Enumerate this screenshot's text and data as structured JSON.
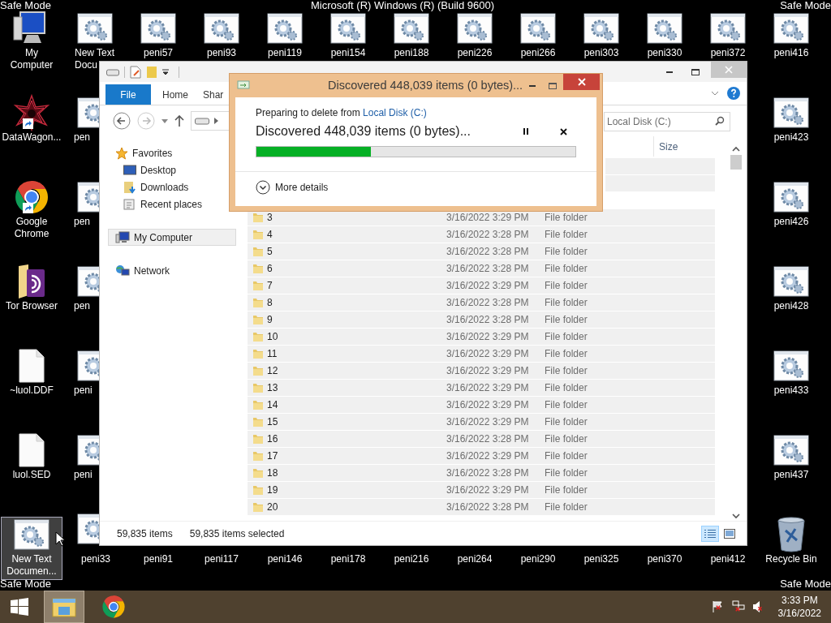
{
  "overlay_texts": {
    "safe_mode": [
      "Safe Mode",
      "Safe Mode",
      "Safe Mode",
      "Safe Mode"
    ],
    "build": "Microsoft (R) Windows (R) (Build 9600)"
  },
  "desktop": {
    "columns": [
      [
        {
          "label": "My Computer",
          "kind": "computer",
          "shortcut": false,
          "selected": false
        },
        {
          "label": "DataWagon...",
          "kind": "star",
          "shortcut": true,
          "selected": false
        },
        {
          "label": "Google Chrome",
          "kind": "chrome",
          "shortcut": true,
          "selected": false
        },
        {
          "label": "Tor Browser",
          "kind": "tor",
          "shortcut": false,
          "selected": false
        },
        {
          "label": "~luol.DDF",
          "kind": "file",
          "shortcut": false,
          "selected": false
        },
        {
          "label": "luol.SED",
          "kind": "file",
          "shortcut": false,
          "selected": false
        },
        {
          "label": "New Text Documen...",
          "kind": "gear",
          "shortcut": false,
          "selected": true
        }
      ],
      [
        {
          "label": "New Text Docu",
          "kind": "gear",
          "shortcut": false,
          "selected": false
        },
        {
          "label": "pen",
          "kind": "gear",
          "shortcut": false,
          "selected": false
        },
        {
          "label": "pen",
          "kind": "gear",
          "shortcut": false,
          "selected": false
        },
        {
          "label": "pen",
          "kind": "gear",
          "shortcut": false,
          "selected": false
        },
        {
          "label": "peni",
          "kind": "gear",
          "shortcut": false,
          "selected": false
        },
        {
          "label": "peni",
          "kind": "gear",
          "shortcut": false,
          "selected": false
        },
        {
          "label": "peni33",
          "kind": "gear",
          "shortcut": false,
          "selected": false
        }
      ],
      [
        {
          "label": "peni57",
          "kind": "gear",
          "shortcut": false,
          "selected": false
        },
        {
          "label": "peni91",
          "selected": false
        }
      ],
      [
        {
          "label": "peni93",
          "kind": "gear",
          "shortcut": false,
          "selected": false
        },
        {
          "label": "peni117",
          "selected": false
        }
      ],
      [
        {
          "label": "peni119",
          "kind": "gear",
          "shortcut": false,
          "selected": false
        },
        {
          "label": "peni146",
          "selected": false
        }
      ],
      [
        {
          "label": "peni154",
          "kind": "gear",
          "shortcut": false,
          "selected": false
        },
        {
          "label": "peni178",
          "selected": false
        }
      ],
      [
        {
          "label": "peni188",
          "kind": "gear",
          "shortcut": false,
          "selected": false
        },
        {
          "label": "peni216",
          "selected": false
        }
      ],
      [
        {
          "label": "peni226",
          "kind": "gear",
          "shortcut": false,
          "selected": false
        },
        {
          "label": "peni264",
          "selected": false
        }
      ],
      [
        {
          "label": "peni266",
          "kind": "gear",
          "shortcut": false,
          "selected": false
        },
        {
          "label": "peni290",
          "selected": false
        }
      ],
      [
        {
          "label": "peni303",
          "kind": "gear",
          "shortcut": false,
          "selected": false
        },
        {
          "label": "peni325",
          "selected": false
        }
      ],
      [
        {
          "label": "peni330",
          "kind": "gear",
          "shortcut": false,
          "selected": false
        },
        {
          "label": "peni370",
          "selected": false
        }
      ],
      [
        {
          "label": "peni372",
          "kind": "gear",
          "shortcut": false,
          "selected": false
        },
        {
          "label": "peni412",
          "selected": false
        }
      ],
      [
        {
          "label": "peni416",
          "kind": "gear",
          "shortcut": false,
          "selected": false
        },
        {
          "label": "peni423",
          "kind": "gear",
          "shortcut": false,
          "selected": false
        },
        {
          "label": "peni426",
          "kind": "gear",
          "shortcut": false,
          "selected": false
        },
        {
          "label": "peni428",
          "kind": "gear",
          "shortcut": false,
          "selected": false
        },
        {
          "label": "peni433",
          "kind": "gear",
          "shortcut": false,
          "selected": false
        },
        {
          "label": "peni437",
          "kind": "gear",
          "shortcut": false,
          "selected": false
        },
        {
          "label": "Recycle Bin",
          "kind": "recycle",
          "shortcut": false,
          "selected": false
        }
      ]
    ]
  },
  "explorer": {
    "ribbon_tabs": [
      {
        "label": "File",
        "selected": true
      },
      {
        "label": "Home",
        "selected": false
      },
      {
        "label": "Shar",
        "selected": false
      }
    ],
    "search": {
      "placeholder": "Local Disk (C:)"
    },
    "nav": [
      {
        "label": "Favorites",
        "kind": "favorites",
        "selected": false,
        "children": [
          {
            "label": "Desktop",
            "kind": "desktop",
            "selected": false
          },
          {
            "label": "Downloads",
            "kind": "downloads",
            "selected": false
          },
          {
            "label": "Recent places",
            "kind": "recent",
            "selected": false
          }
        ]
      },
      {
        "label": "My Computer",
        "kind": "computer",
        "selected": true
      },
      {
        "label": "Network",
        "kind": "network",
        "selected": false
      }
    ],
    "size_header": "Size",
    "rows": [
      {
        "name": "3",
        "date": "3/16/2022 3:29 PM",
        "type": "File folder",
        "selected": true
      },
      {
        "name": "4",
        "date": "3/16/2022 3:28 PM",
        "type": "File folder",
        "selected": true
      },
      {
        "name": "5",
        "date": "3/16/2022 3:28 PM",
        "type": "File folder",
        "selected": true
      },
      {
        "name": "6",
        "date": "3/16/2022 3:28 PM",
        "type": "File folder",
        "selected": true
      },
      {
        "name": "7",
        "date": "3/16/2022 3:29 PM",
        "type": "File folder",
        "selected": true
      },
      {
        "name": "8",
        "date": "3/16/2022 3:28 PM",
        "type": "File folder",
        "selected": true
      },
      {
        "name": "9",
        "date": "3/16/2022 3:28 PM",
        "type": "File folder",
        "selected": true
      },
      {
        "name": "10",
        "date": "3/16/2022 3:29 PM",
        "type": "File folder",
        "selected": true
      },
      {
        "name": "11",
        "date": "3/16/2022 3:29 PM",
        "type": "File folder",
        "selected": true
      },
      {
        "name": "12",
        "date": "3/16/2022 3:29 PM",
        "type": "File folder",
        "selected": true
      },
      {
        "name": "13",
        "date": "3/16/2022 3:29 PM",
        "type": "File folder",
        "selected": true
      },
      {
        "name": "14",
        "date": "3/16/2022 3:29 PM",
        "type": "File folder",
        "selected": true
      },
      {
        "name": "15",
        "date": "3/16/2022 3:29 PM",
        "type": "File folder",
        "selected": true
      },
      {
        "name": "16",
        "date": "3/16/2022 3:28 PM",
        "type": "File folder",
        "selected": true
      },
      {
        "name": "17",
        "date": "3/16/2022 3:29 PM",
        "type": "File folder",
        "selected": true
      },
      {
        "name": "18",
        "date": "3/16/2022 3:28 PM",
        "type": "File folder",
        "selected": true
      },
      {
        "name": "19",
        "date": "3/16/2022 3:29 PM",
        "type": "File folder",
        "selected": true
      },
      {
        "name": "20",
        "date": "3/16/2022 3:28 PM",
        "type": "File folder",
        "selected": true
      }
    ],
    "status": {
      "item_count": "59,835 items",
      "selection": "59,835 items selected"
    },
    "views": [
      {
        "kind": "details",
        "selected": true
      },
      {
        "kind": "thumbnails",
        "selected": false
      }
    ]
  },
  "dialog": {
    "title": "Discovered 448,039 items (0 bytes)...",
    "preparing_text": "Preparing to delete from",
    "location_link": "Local Disk (C:)",
    "status": "Discovered 448,039 items (0 bytes)...",
    "progress": {
      "level": 0.36
    },
    "more_details": "More details"
  },
  "taskbar": {
    "apps": [
      {
        "kind": "start",
        "selected": false
      },
      {
        "kind": "explorer",
        "selected": true
      },
      {
        "kind": "chrome",
        "selected": false
      }
    ],
    "tray": [
      {
        "kind": "flag"
      },
      {
        "kind": "network"
      },
      {
        "kind": "speaker"
      }
    ],
    "time": "3:33 PM",
    "date": "3/16/2022"
  }
}
